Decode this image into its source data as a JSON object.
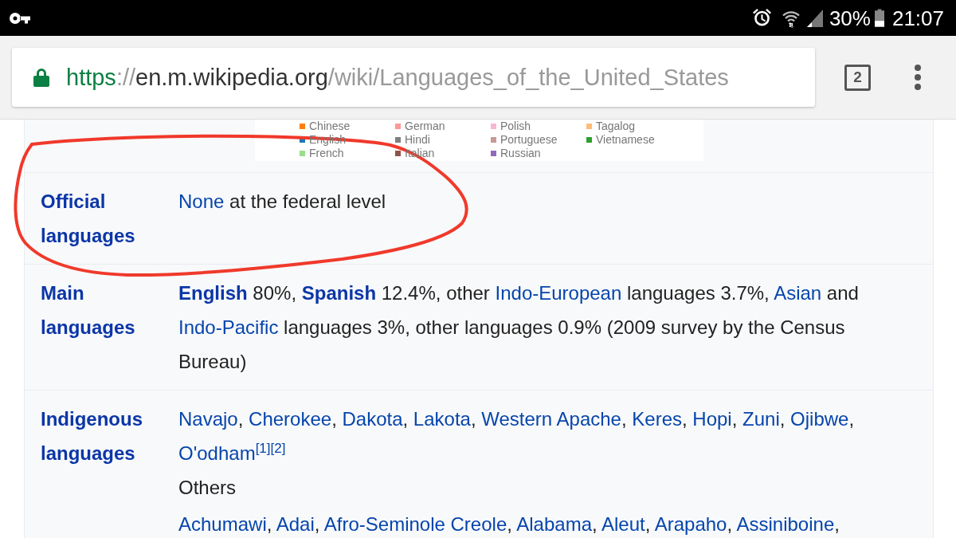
{
  "status_bar": {
    "battery": "30%",
    "time": "21:07"
  },
  "browser": {
    "url": {
      "scheme": "https",
      "separator": "://",
      "host": "en.m.wikipedia.org",
      "path": "/wiki/Languages_of_the_United_States"
    },
    "tab_count": "2"
  },
  "chart_legend": [
    {
      "label": "Chinese",
      "color": "#ff7f0e"
    },
    {
      "label": "German",
      "color": "#ff9896"
    },
    {
      "label": "Polish",
      "color": "#f7b6d2"
    },
    {
      "label": "Tagalog",
      "color": "#ffbb78"
    },
    {
      "label": "English",
      "color": "#1f77b4"
    },
    {
      "label": "Hindi",
      "color": "#7f7f7f"
    },
    {
      "label": "Portuguese",
      "color": "#c49c94"
    },
    {
      "label": "Vietnamese",
      "color": "#2ca02c"
    },
    {
      "label": "French",
      "color": "#98df8a"
    },
    {
      "label": "Italian",
      "color": "#8c564b"
    },
    {
      "label": "Russian",
      "color": "#9467bd"
    }
  ],
  "infobox": {
    "rows": [
      {
        "label": "Official languages",
        "paragraphs": [
          {
            "kind": "text",
            "runs": [
              {
                "kind": "link",
                "text": "None",
                "bold": false
              },
              {
                "kind": "text",
                "text": " at the federal level"
              }
            ]
          }
        ]
      },
      {
        "label": "Main languages",
        "paragraphs": [
          {
            "kind": "text",
            "runs": [
              {
                "kind": "link",
                "text": "English",
                "bold": true
              },
              {
                "kind": "text",
                "text": " 80%, "
              },
              {
                "kind": "link",
                "text": "Spanish",
                "bold": true
              },
              {
                "kind": "text",
                "text": " 12.4%, other "
              },
              {
                "kind": "link",
                "text": "Indo-European",
                "bold": false
              },
              {
                "kind": "text",
                "text": " languages 3.7%, "
              },
              {
                "kind": "link",
                "text": "Asian",
                "bold": false
              },
              {
                "kind": "text",
                "text": " and "
              },
              {
                "kind": "link",
                "text": "Indo-Pacific",
                "bold": false
              },
              {
                "kind": "text",
                "text": " languages 3%, other languages 0.9% (2009 survey by the Census Bureau)"
              }
            ]
          }
        ]
      },
      {
        "label": "Indigenous languages",
        "paragraphs": [
          {
            "kind": "text",
            "runs": [
              {
                "kind": "link",
                "text": "Navajo",
                "bold": false
              },
              {
                "kind": "text",
                "text": ", "
              },
              {
                "kind": "link",
                "text": "Cherokee",
                "bold": false
              },
              {
                "kind": "text",
                "text": ", "
              },
              {
                "kind": "link",
                "text": "Dakota",
                "bold": false
              },
              {
                "kind": "text",
                "text": ", "
              },
              {
                "kind": "link",
                "text": "Lakota",
                "bold": false
              },
              {
                "kind": "text",
                "text": ", "
              },
              {
                "kind": "link",
                "text": "Western Apache",
                "bold": false
              },
              {
                "kind": "text",
                "text": ", "
              },
              {
                "kind": "link",
                "text": "Keres",
                "bold": false
              },
              {
                "kind": "text",
                "text": ", "
              },
              {
                "kind": "link",
                "text": "Hopi",
                "bold": false
              },
              {
                "kind": "text",
                "text": ", "
              },
              {
                "kind": "link",
                "text": "Zuni",
                "bold": false
              },
              {
                "kind": "text",
                "text": ", "
              },
              {
                "kind": "link",
                "text": "Ojibwe",
                "bold": false
              },
              {
                "kind": "text",
                "text": ", "
              },
              {
                "kind": "link",
                "text": "O'odham",
                "bold": false
              },
              {
                "kind": "ref",
                "text": "[1]"
              },
              {
                "kind": "ref",
                "text": "[2]"
              }
            ]
          },
          {
            "kind": "title",
            "runs": [
              {
                "kind": "text",
                "text": "Others"
              }
            ]
          },
          {
            "kind": "list",
            "runs": [
              {
                "kind": "link",
                "text": "Achumawi",
                "bold": false
              },
              {
                "kind": "text",
                "text": ", "
              },
              {
                "kind": "link",
                "text": "Adai",
                "bold": false
              },
              {
                "kind": "text",
                "text": ", "
              },
              {
                "kind": "link",
                "text": "Afro-Seminole Creole",
                "bold": false
              },
              {
                "kind": "text",
                "text": ", "
              },
              {
                "kind": "link",
                "text": "Alabama",
                "bold": false
              },
              {
                "kind": "text",
                "text": ", "
              },
              {
                "kind": "link",
                "text": "Aleut",
                "bold": false
              },
              {
                "kind": "text",
                "text": ", "
              },
              {
                "kind": "link",
                "text": "Arapaho",
                "bold": false
              },
              {
                "kind": "text",
                "text": ", "
              },
              {
                "kind": "link",
                "text": "Assiniboine",
                "bold": false
              },
              {
                "kind": "text",
                "text": ","
              }
            ]
          }
        ]
      }
    ]
  }
}
